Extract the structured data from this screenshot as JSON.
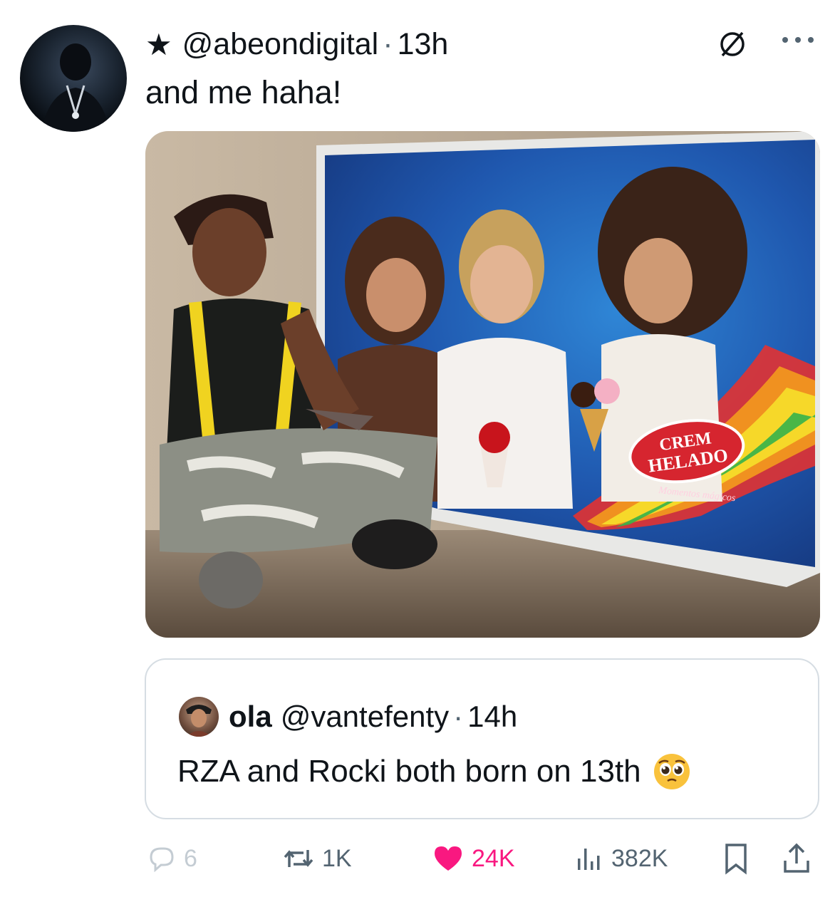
{
  "header": {
    "handle": "@abeondigital",
    "separator": "·",
    "time": "13h"
  },
  "tweet": {
    "text": "and me haha!"
  },
  "media": {
    "brand_line1": "CREM",
    "brand_line2": "HELADO",
    "tagline": "Momentos mágicos"
  },
  "quote": {
    "name": "ola",
    "handle": "@vantefenty",
    "separator": "·",
    "time": "14h",
    "text": "RZA and Rocki both born on 13th"
  },
  "actions": {
    "replies": "6",
    "reposts": "1K",
    "likes": "24K",
    "views": "382K"
  },
  "colors": {
    "like_active": "#f91880",
    "muted_text": "#536471",
    "border": "#d6dde3"
  }
}
